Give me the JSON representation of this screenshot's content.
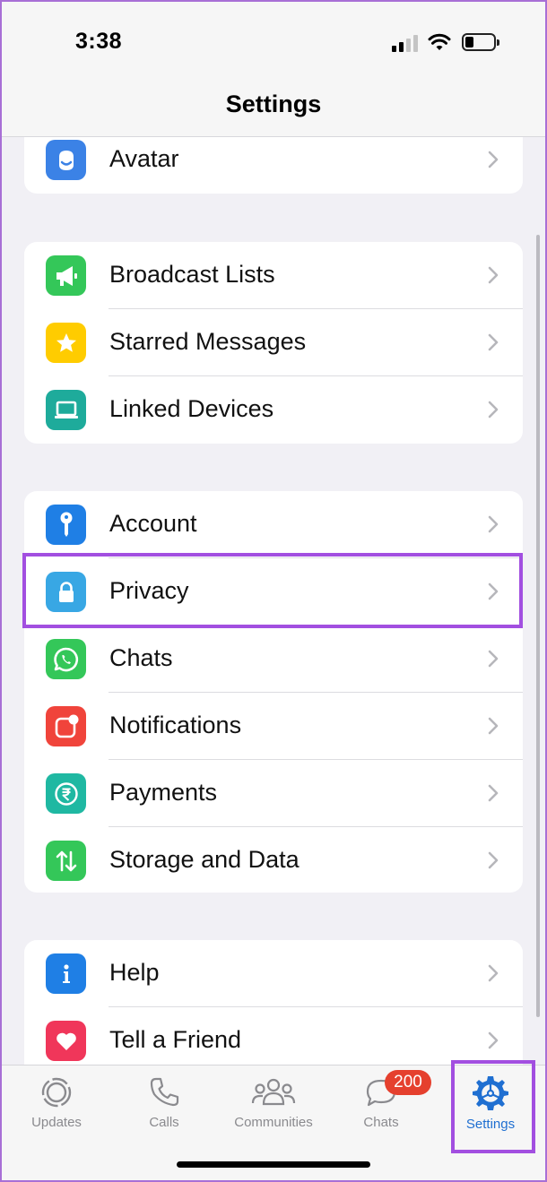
{
  "status": {
    "time": "3:38"
  },
  "header": {
    "title": "Settings"
  },
  "groups": {
    "g1": [
      {
        "label": "Avatar",
        "icon": "avatar-icon",
        "color": "#3b82e6"
      }
    ],
    "g2": [
      {
        "label": "Broadcast Lists",
        "icon": "megaphone-icon",
        "color": "#34c759"
      },
      {
        "label": "Starred Messages",
        "icon": "star-icon",
        "color": "#ffcc00"
      },
      {
        "label": "Linked Devices",
        "icon": "laptop-icon",
        "color": "#1eab9b"
      }
    ],
    "g3": [
      {
        "label": "Account",
        "icon": "key-icon",
        "color": "#1f7fe5"
      },
      {
        "label": "Privacy",
        "icon": "lock-icon",
        "color": "#38a7e4"
      },
      {
        "label": "Chats",
        "icon": "whatsapp-icon",
        "color": "#34c759"
      },
      {
        "label": "Notifications",
        "icon": "notification-icon",
        "color": "#f0443b"
      },
      {
        "label": "Payments",
        "icon": "rupee-icon",
        "color": "#1fb8a2"
      },
      {
        "label": "Storage and Data",
        "icon": "arrows-icon",
        "color": "#34c759"
      }
    ],
    "g4": [
      {
        "label": "Help",
        "icon": "info-icon",
        "color": "#1f7fe5"
      },
      {
        "label": "Tell a Friend",
        "icon": "heart-icon",
        "color": "#f0365a"
      }
    ]
  },
  "tabs": [
    {
      "label": "Updates",
      "icon": "updates-icon"
    },
    {
      "label": "Calls",
      "icon": "phone-icon"
    },
    {
      "label": "Communities",
      "icon": "communities-icon"
    },
    {
      "label": "Chats",
      "icon": "chats-icon",
      "badge": "200"
    },
    {
      "label": "Settings",
      "icon": "settings-icon",
      "active": true
    }
  ],
  "colors": {
    "accent": "#1f6fd1",
    "highlight": "#a24fe0",
    "badge": "#e5402e"
  }
}
